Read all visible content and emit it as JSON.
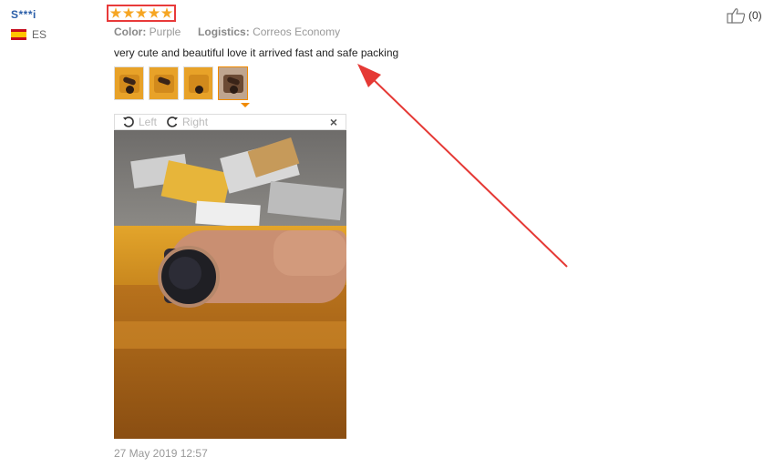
{
  "reviewer": {
    "name": "S***i",
    "country": "ES"
  },
  "rating": {
    "stars": 5,
    "max": 5
  },
  "attributes": {
    "color_label": "Color:",
    "color_value": "Purple",
    "logistics_label": "Logistics:",
    "logistics_value": "Correos Economy"
  },
  "review_text": "very cute and beautiful love it arrived fast and safe packing",
  "thumbnails": {
    "count": 4,
    "active_index": 3
  },
  "viewer": {
    "left_label": "Left",
    "right_label": "Right",
    "close_label": "×"
  },
  "date": "27 May 2019 12:57",
  "helpful": {
    "count_label": "(0)"
  },
  "colors": {
    "highlight_border": "#e83a3a",
    "star": "#f6a623",
    "username": "#2a5ea8",
    "active_thumb": "#f08a00"
  },
  "icons": [
    "flag-es-icon",
    "star-icon",
    "rotate-left-icon",
    "rotate-right-icon",
    "close-icon",
    "thumbs-up-icon"
  ]
}
